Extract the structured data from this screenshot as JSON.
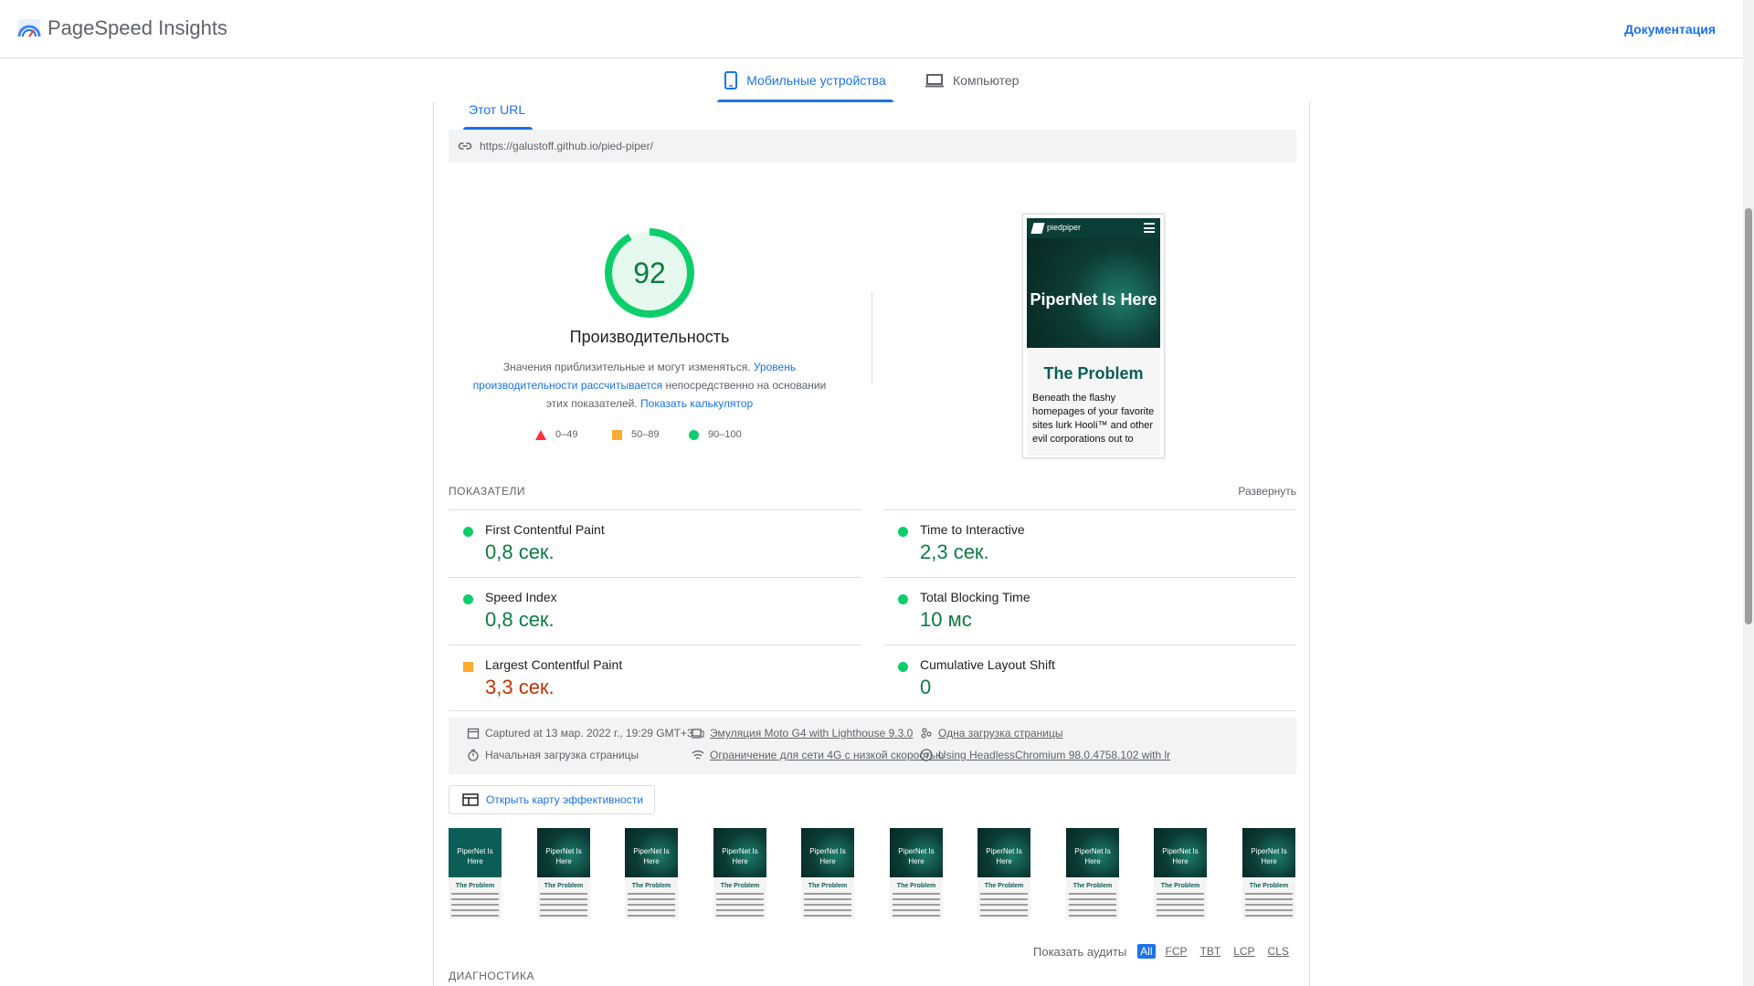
{
  "header": {
    "brand": "PageSpeed Insights",
    "docs_link": "Документация"
  },
  "device_tabs": [
    {
      "label": "Мобильные устройства",
      "icon": "smartphone-icon",
      "active": true
    },
    {
      "label": "Компьютер",
      "icon": "laptop-icon",
      "active": false
    }
  ],
  "url_tab": "Этот URL",
  "url": "https://galustoff.github.io/pied-piper/",
  "performance": {
    "score": "92",
    "title": "Производительность",
    "desc_1": "Значения приблизительные и могут изменяться.",
    "desc_link_1": "Уровень производительности рассчитывается",
    "desc_2": "непосредственно на основании этих показателей.",
    "desc_link_2": "Показать калькулятор",
    "legend": {
      "fail": "0–49",
      "average": "50–89",
      "pass": "90–100"
    },
    "colors": {
      "pass": "#0cce6b",
      "average": "#ffaa33",
      "fail": "#ff3333",
      "pass_text": "#0c7c40",
      "average_text": "#c33300"
    }
  },
  "preview": {
    "brand": "piedpiper",
    "hero_title": "PiperNet Is Here",
    "section_title": "The Problem",
    "body": "Beneath the flashy homepages of your favorite sites lurk Hooli™ and other evil corporations out to"
  },
  "metrics": {
    "heading": "ПОКАЗАТЕЛИ",
    "expand": "Развернуть",
    "items": [
      {
        "name": "First Contentful Paint",
        "value": "0,8 сек.",
        "rating": "pass"
      },
      {
        "name": "Time to Interactive",
        "value": "2,3 сек.",
        "rating": "pass"
      },
      {
        "name": "Speed Index",
        "value": "0,8 сек.",
        "rating": "pass"
      },
      {
        "name": "Total Blocking Time",
        "value": "10 мс",
        "rating": "pass"
      },
      {
        "name": "Largest Contentful Paint",
        "value": "3,3 сек.",
        "rating": "average"
      },
      {
        "name": "Cumulative Layout Shift",
        "value": "0",
        "rating": "pass"
      }
    ]
  },
  "runtime": {
    "captured": "Captured at 13 мар. 2022 г., 19:29 GMT+3",
    "load": "Начальная загрузка страницы",
    "emulation": "Эмуляция Moto G4 with Lighthouse 9.3.0",
    "throttling": "Ограничение для сети 4G с низкой скоростью",
    "single_load": "Одна загрузка страницы",
    "browser": "Using HeadlessChromium 98.0.4758.102 with lr"
  },
  "treemap_button": "Открыть карту эффективности",
  "filmstrip": {
    "first_frame_title": "PiperNet Is Here",
    "frame_title": "PiperNet Is Here",
    "frame_section": "The Problem"
  },
  "audit_filter": {
    "label": "Показать аудиты",
    "chips": [
      "All",
      "FCP",
      "TBT",
      "LCP",
      "CLS"
    ],
    "active": "All"
  },
  "diagnostics_heading": "ДИАГНОСТИКА"
}
